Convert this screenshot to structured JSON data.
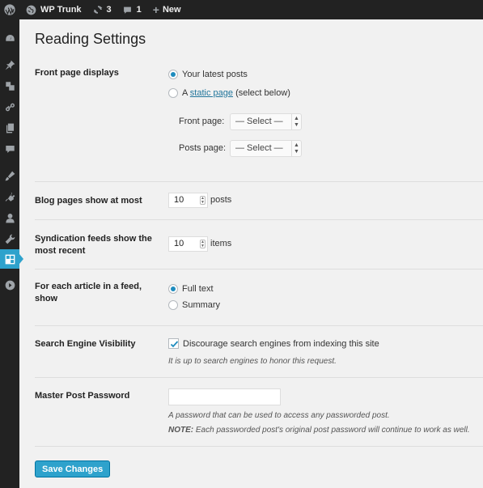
{
  "admin_bar": {
    "site_name": "WP Trunk",
    "updates_count": "3",
    "comments_count": "1",
    "new_label": "New",
    "new_plus": "+"
  },
  "sidebar": {
    "items": [
      {
        "icon": "dashboard-icon"
      },
      {
        "icon": "pin-icon"
      },
      {
        "icon": "media-icon"
      },
      {
        "icon": "links-icon"
      },
      {
        "icon": "pages-icon"
      },
      {
        "icon": "comments-icon"
      },
      {
        "icon": "appearance-icon"
      },
      {
        "icon": "plugins-icon"
      },
      {
        "icon": "users-icon"
      },
      {
        "icon": "tools-icon"
      },
      {
        "icon": "settings-icon",
        "current": true
      },
      {
        "icon": "collapse-icon"
      }
    ],
    "accent_color": "#2ea2cc"
  },
  "page": {
    "title": "Reading Settings"
  },
  "front_page": {
    "label": "Front page displays",
    "option_latest": "Your latest posts",
    "option_static_prefix": "A",
    "option_static_link": "static page",
    "option_static_suffix": "(select below)",
    "selected": "latest",
    "front_page_label": "Front page:",
    "front_page_value": "— Select —",
    "posts_page_label": "Posts page:",
    "posts_page_value": "— Select —"
  },
  "blog_pages": {
    "label": "Blog pages show at most",
    "value": "10",
    "unit": "posts"
  },
  "syndication": {
    "label_line1": "Syndication feeds show the",
    "label_line2": "most recent",
    "value": "10",
    "unit": "items"
  },
  "feed_article": {
    "label_line1": "For each article in a feed,",
    "label_line2": "show",
    "option_full": "Full text",
    "option_summary": "Summary",
    "selected": "full"
  },
  "search_visibility": {
    "label": "Search Engine Visibility",
    "checkbox_label": "Discourage search engines from indexing this site",
    "checked": true,
    "description": "It is up to search engines to honor this request."
  },
  "master_password": {
    "label": "Master Post Password",
    "value": "",
    "description": "A password that can be used to access any passworded post.",
    "note_prefix": "NOTE:",
    "note_text": "Each passworded post's original post password will continue to work as well."
  },
  "actions": {
    "save_label": "Save Changes"
  },
  "colors": {
    "admin_bar_bg": "#222222",
    "primary_button": "#2ea2cc",
    "radio_checked": "#1e8cbe",
    "link": "#21759b"
  }
}
